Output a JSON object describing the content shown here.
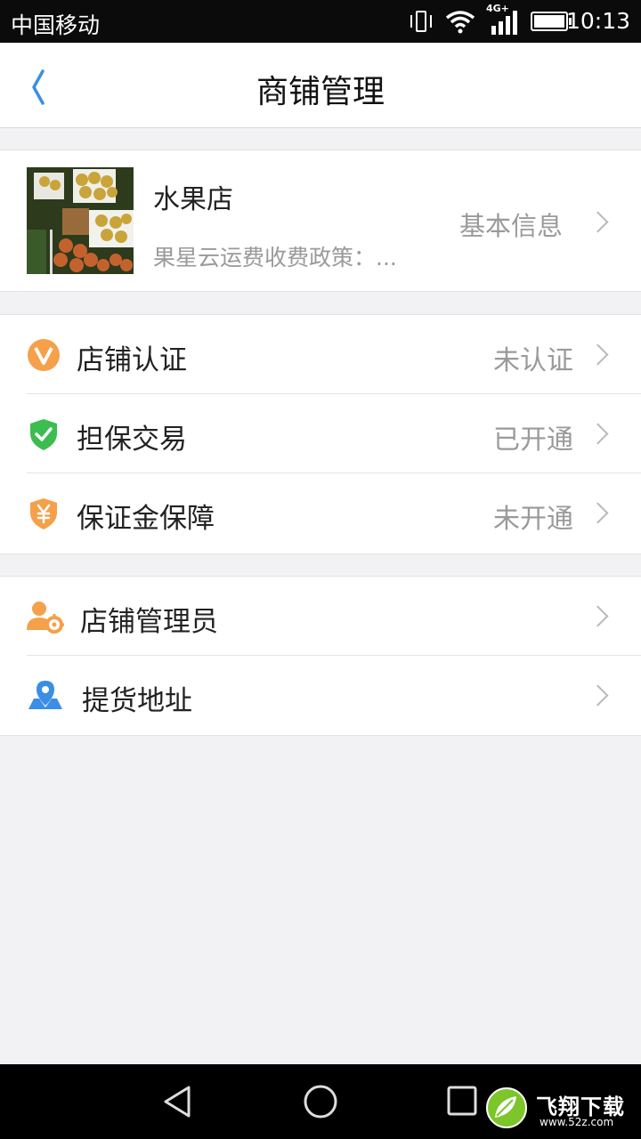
{
  "status_bar": {
    "carrier": "中国移动",
    "network": "4G+",
    "time": "10:13"
  },
  "header": {
    "title": "商铺管理",
    "back_icon": "chevron-left-icon"
  },
  "shop": {
    "name": "水果店",
    "description": "果星云运费收费政策：...",
    "basic_info_label": "基本信息"
  },
  "verification_group": [
    {
      "label": "店铺认证",
      "value": "未认证",
      "icon": "v-badge-icon"
    },
    {
      "label": "担保交易",
      "value": "已开通",
      "icon": "shield-check-icon"
    },
    {
      "label": "保证金保障",
      "value": "未开通",
      "icon": "shield-yen-icon"
    }
  ],
  "manage_group": [
    {
      "label": "店铺管理员",
      "icon": "user-gear-icon"
    },
    {
      "label": "提货地址",
      "icon": "map-pin-icon"
    }
  ],
  "watermark": {
    "text": "飞翔下载",
    "url": "www.52z.com"
  },
  "colors": {
    "accent_blue": "#3a8ee6",
    "orange": "#f5a04a",
    "green": "#3cbd4f",
    "text_primary": "#222222",
    "text_secondary": "#9a9a9a",
    "page_bg": "#f2f2f4"
  }
}
